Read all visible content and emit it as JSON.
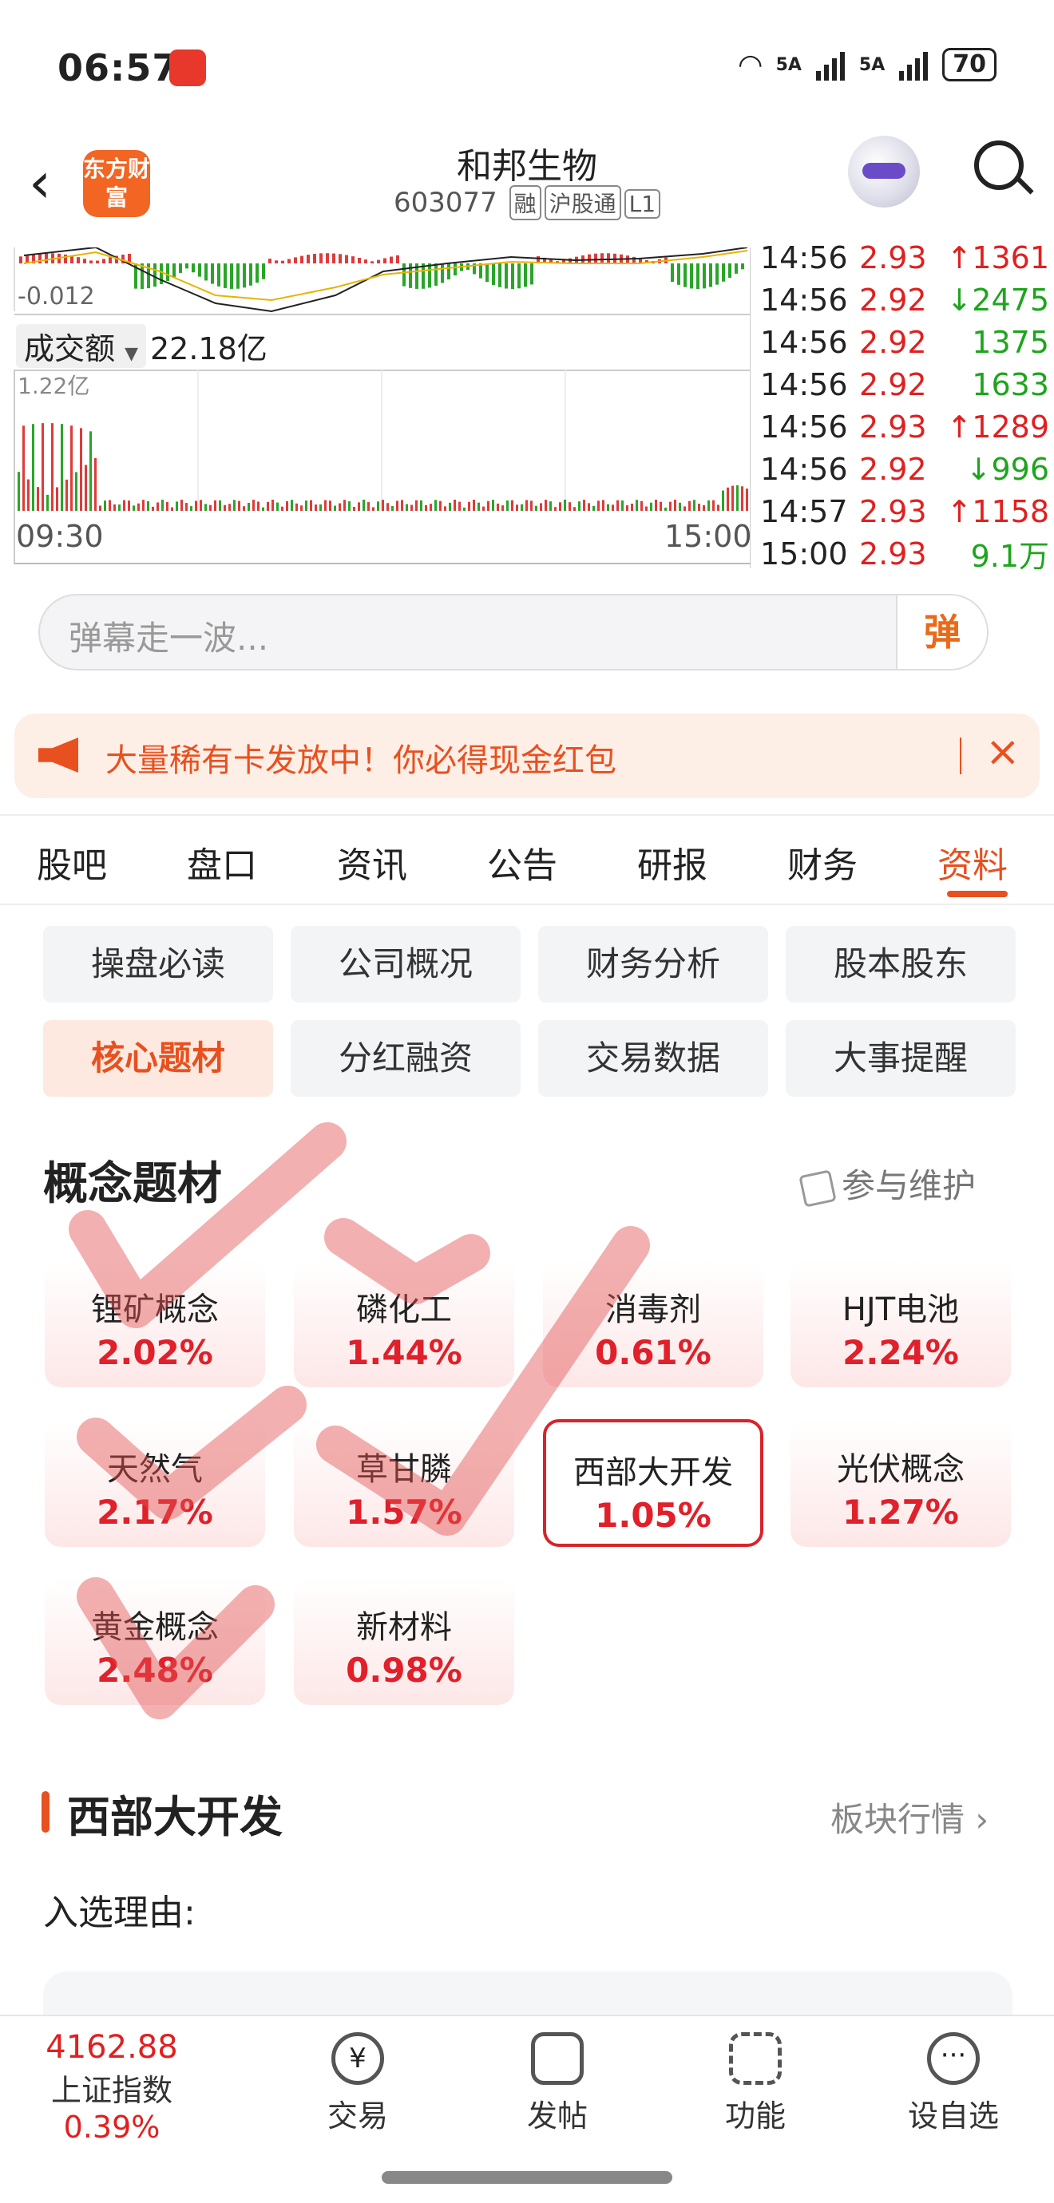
{
  "status_bar": {
    "time": "06:57",
    "signal1": "5A",
    "signal2": "5A",
    "battery": "70"
  },
  "header": {
    "stock_name": "和邦生物",
    "stock_code": "603077",
    "tags": [
      "融",
      "沪股通",
      "L1"
    ],
    "logo_text": "东方财富"
  },
  "chart": {
    "macd_value": "-0.012",
    "volume_label": "成交额",
    "volume_total": "22.18亿",
    "volume_max": "1.22亿",
    "time_start": "09:30",
    "time_end": "15:00",
    "ticks": [
      {
        "time": "14:56",
        "price": "2.93",
        "dir": "up",
        "vol": "1361"
      },
      {
        "time": "14:56",
        "price": "2.92",
        "dir": "dn",
        "vol": "2475"
      },
      {
        "time": "14:56",
        "price": "2.92",
        "dir": "",
        "vol": "1375"
      },
      {
        "time": "14:56",
        "price": "2.92",
        "dir": "",
        "vol": "1633"
      },
      {
        "time": "14:56",
        "price": "2.93",
        "dir": "up",
        "vol": "1289"
      },
      {
        "time": "14:56",
        "price": "2.92",
        "dir": "dn",
        "vol": "996"
      },
      {
        "time": "14:57",
        "price": "2.93",
        "dir": "up",
        "vol": "1158"
      },
      {
        "time": "15:00",
        "price": "2.93",
        "dir": "",
        "vol": "9.1万"
      }
    ]
  },
  "danmu": {
    "placeholder": "弹幕走一波...",
    "button": "弹"
  },
  "promo": {
    "text": "大量稀有卡发放中！你必得现金红包"
  },
  "tabs": [
    "股吧",
    "盘口",
    "资讯",
    "公告",
    "研报",
    "财务",
    "资料"
  ],
  "active_tab": "资料",
  "sub_buttons": [
    "操盘必读",
    "公司概况",
    "财务分析",
    "股本股东",
    "核心题材",
    "分红融资",
    "交易数据",
    "大事提醒"
  ],
  "active_sub": "核心题材",
  "concepts": {
    "title": "概念题材",
    "maintain": "参与维护",
    "items": [
      {
        "name": "锂矿概念",
        "change": "2.02%"
      },
      {
        "name": "磷化工",
        "change": "1.44%"
      },
      {
        "name": "消毒剂",
        "change": "0.61%"
      },
      {
        "name": "HJT电池",
        "change": "2.24%"
      },
      {
        "name": "天然气",
        "change": "2.17%"
      },
      {
        "name": "草甘膦",
        "change": "1.57%"
      },
      {
        "name": "西部大开发",
        "change": "1.05%"
      },
      {
        "name": "光伏概念",
        "change": "1.27%"
      },
      {
        "name": "黄金概念",
        "change": "2.48%"
      },
      {
        "name": "新材料",
        "change": "0.98%"
      }
    ],
    "selected": "西部大开发"
  },
  "section": {
    "title": "西部大开发",
    "link": "板块行情",
    "reason_label": "入选理由:"
  },
  "bottom": {
    "index_value": "4162.88",
    "index_name": "上证指数",
    "index_change": "0.39%",
    "nav": [
      "交易",
      "发帖",
      "功能",
      "设自选"
    ]
  },
  "colors": {
    "accent": "#e8501f",
    "up": "#e02020",
    "down": "#1ea51e"
  }
}
